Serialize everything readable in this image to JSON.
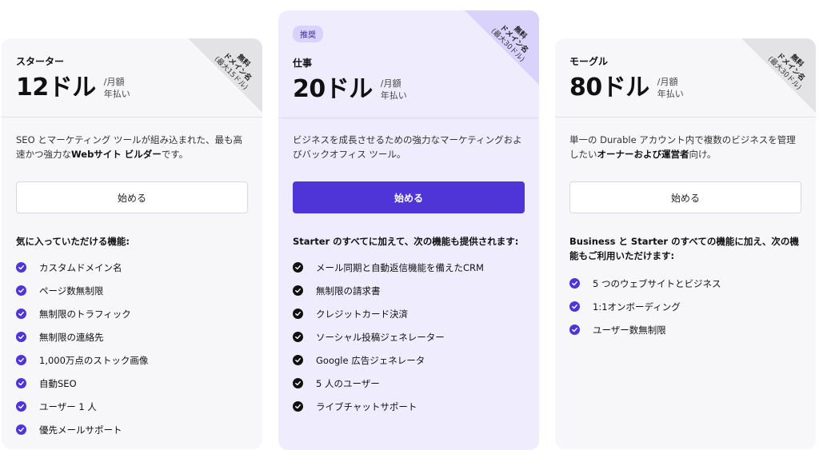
{
  "plans": [
    {
      "name": "スターター",
      "price": "12ドル",
      "period_line1": "/月額",
      "period_line2": "年払い",
      "corner": {
        "line1": "無料",
        "line2": "ドメイン名",
        "line3": "(最大15ドル)"
      },
      "desc_pre": "SEO とマーケティング ツールが組み込まれた、最も高速かつ強力な",
      "desc_bold": "Webサイト ビルダー",
      "desc_post": "です。",
      "cta": "始める",
      "features_title": "気に入っていただける機能:",
      "features": [
        "カスタムドメイン名",
        "ページ数無制限",
        "無制限のトラフィック",
        "無制限の連絡先",
        "1,000万点のストック画像",
        "自動SEO",
        "ユーザー 1 人",
        "優先メールサポート"
      ]
    },
    {
      "badge": "推奨",
      "name": "仕事",
      "price": "20ドル",
      "period_line1": "/月額",
      "period_line2": "年払い",
      "corner": {
        "line1": "無料",
        "line2": "ドメイン名",
        "line3": "(最大30ドル)"
      },
      "desc_pre": "ビジネスを成長させるための強力なマーケティングおよびバックオフィス ツール。",
      "desc_bold": "",
      "desc_post": "",
      "cta": "始める",
      "features_title": "Starter のすべてに加えて、次の機能も提供されます:",
      "features": [
        "メール同期と自動返信機能を備えたCRM",
        "無制限の請求書",
        "クレジットカード決済",
        "ソーシャル投稿ジェネレーター",
        "Google 広告ジェネレータ",
        "5 人のユーザー",
        "ライブチャットサポート"
      ]
    },
    {
      "name": "モーグル",
      "price": "80ドル",
      "period_line1": "/月額",
      "period_line2": "年払い",
      "corner": {
        "line1": "無料",
        "line2": "ドメイン名",
        "line3": "(最大30ドル)"
      },
      "desc_pre": "単一の Durable アカウント内で複数のビジネスを管理したい",
      "desc_bold": "オーナーおよび運営者",
      "desc_post": "向け。",
      "cta": "始める",
      "features_title": "Business と Starter のすべての機能に加え、次の機能もご利用いただけます:",
      "features": [
        "5 つのウェブサイトとビジネス",
        "1:1オンボーディング",
        "ユーザー数無制限"
      ]
    }
  ],
  "colors": {
    "accent": "#4f35d8",
    "recommended_bg": "#efecfd",
    "card_bg": "#f7f7f9"
  },
  "icons": {
    "feature_check": "check-circle-icon"
  }
}
